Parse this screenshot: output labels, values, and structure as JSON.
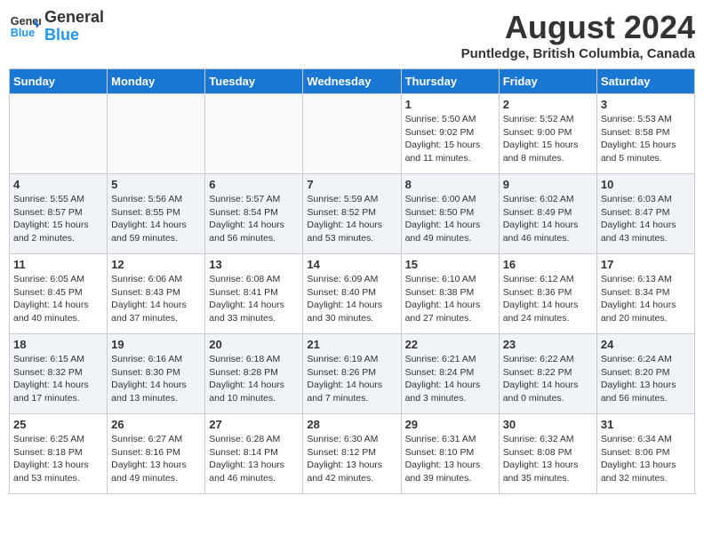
{
  "header": {
    "logo_line1": "General",
    "logo_line2": "Blue",
    "month_title": "August 2024",
    "location": "Puntledge, British Columbia, Canada"
  },
  "days_of_week": [
    "Sunday",
    "Monday",
    "Tuesday",
    "Wednesday",
    "Thursday",
    "Friday",
    "Saturday"
  ],
  "weeks": [
    [
      {
        "day": "",
        "info": ""
      },
      {
        "day": "",
        "info": ""
      },
      {
        "day": "",
        "info": ""
      },
      {
        "day": "",
        "info": ""
      },
      {
        "day": "1",
        "info": "Sunrise: 5:50 AM\nSunset: 9:02 PM\nDaylight: 15 hours\nand 11 minutes."
      },
      {
        "day": "2",
        "info": "Sunrise: 5:52 AM\nSunset: 9:00 PM\nDaylight: 15 hours\nand 8 minutes."
      },
      {
        "day": "3",
        "info": "Sunrise: 5:53 AM\nSunset: 8:58 PM\nDaylight: 15 hours\nand 5 minutes."
      }
    ],
    [
      {
        "day": "4",
        "info": "Sunrise: 5:55 AM\nSunset: 8:57 PM\nDaylight: 15 hours\nand 2 minutes."
      },
      {
        "day": "5",
        "info": "Sunrise: 5:56 AM\nSunset: 8:55 PM\nDaylight: 14 hours\nand 59 minutes."
      },
      {
        "day": "6",
        "info": "Sunrise: 5:57 AM\nSunset: 8:54 PM\nDaylight: 14 hours\nand 56 minutes."
      },
      {
        "day": "7",
        "info": "Sunrise: 5:59 AM\nSunset: 8:52 PM\nDaylight: 14 hours\nand 53 minutes."
      },
      {
        "day": "8",
        "info": "Sunrise: 6:00 AM\nSunset: 8:50 PM\nDaylight: 14 hours\nand 49 minutes."
      },
      {
        "day": "9",
        "info": "Sunrise: 6:02 AM\nSunset: 8:49 PM\nDaylight: 14 hours\nand 46 minutes."
      },
      {
        "day": "10",
        "info": "Sunrise: 6:03 AM\nSunset: 8:47 PM\nDaylight: 14 hours\nand 43 minutes."
      }
    ],
    [
      {
        "day": "11",
        "info": "Sunrise: 6:05 AM\nSunset: 8:45 PM\nDaylight: 14 hours\nand 40 minutes."
      },
      {
        "day": "12",
        "info": "Sunrise: 6:06 AM\nSunset: 8:43 PM\nDaylight: 14 hours\nand 37 minutes."
      },
      {
        "day": "13",
        "info": "Sunrise: 6:08 AM\nSunset: 8:41 PM\nDaylight: 14 hours\nand 33 minutes."
      },
      {
        "day": "14",
        "info": "Sunrise: 6:09 AM\nSunset: 8:40 PM\nDaylight: 14 hours\nand 30 minutes."
      },
      {
        "day": "15",
        "info": "Sunrise: 6:10 AM\nSunset: 8:38 PM\nDaylight: 14 hours\nand 27 minutes."
      },
      {
        "day": "16",
        "info": "Sunrise: 6:12 AM\nSunset: 8:36 PM\nDaylight: 14 hours\nand 24 minutes."
      },
      {
        "day": "17",
        "info": "Sunrise: 6:13 AM\nSunset: 8:34 PM\nDaylight: 14 hours\nand 20 minutes."
      }
    ],
    [
      {
        "day": "18",
        "info": "Sunrise: 6:15 AM\nSunset: 8:32 PM\nDaylight: 14 hours\nand 17 minutes."
      },
      {
        "day": "19",
        "info": "Sunrise: 6:16 AM\nSunset: 8:30 PM\nDaylight: 14 hours\nand 13 minutes."
      },
      {
        "day": "20",
        "info": "Sunrise: 6:18 AM\nSunset: 8:28 PM\nDaylight: 14 hours\nand 10 minutes."
      },
      {
        "day": "21",
        "info": "Sunrise: 6:19 AM\nSunset: 8:26 PM\nDaylight: 14 hours\nand 7 minutes."
      },
      {
        "day": "22",
        "info": "Sunrise: 6:21 AM\nSunset: 8:24 PM\nDaylight: 14 hours\nand 3 minutes."
      },
      {
        "day": "23",
        "info": "Sunrise: 6:22 AM\nSunset: 8:22 PM\nDaylight: 14 hours\nand 0 minutes."
      },
      {
        "day": "24",
        "info": "Sunrise: 6:24 AM\nSunset: 8:20 PM\nDaylight: 13 hours\nand 56 minutes."
      }
    ],
    [
      {
        "day": "25",
        "info": "Sunrise: 6:25 AM\nSunset: 8:18 PM\nDaylight: 13 hours\nand 53 minutes."
      },
      {
        "day": "26",
        "info": "Sunrise: 6:27 AM\nSunset: 8:16 PM\nDaylight: 13 hours\nand 49 minutes."
      },
      {
        "day": "27",
        "info": "Sunrise: 6:28 AM\nSunset: 8:14 PM\nDaylight: 13 hours\nand 46 minutes."
      },
      {
        "day": "28",
        "info": "Sunrise: 6:30 AM\nSunset: 8:12 PM\nDaylight: 13 hours\nand 42 minutes."
      },
      {
        "day": "29",
        "info": "Sunrise: 6:31 AM\nSunset: 8:10 PM\nDaylight: 13 hours\nand 39 minutes."
      },
      {
        "day": "30",
        "info": "Sunrise: 6:32 AM\nSunset: 8:08 PM\nDaylight: 13 hours\nand 35 minutes."
      },
      {
        "day": "31",
        "info": "Sunrise: 6:34 AM\nSunset: 8:06 PM\nDaylight: 13 hours\nand 32 minutes."
      }
    ]
  ]
}
